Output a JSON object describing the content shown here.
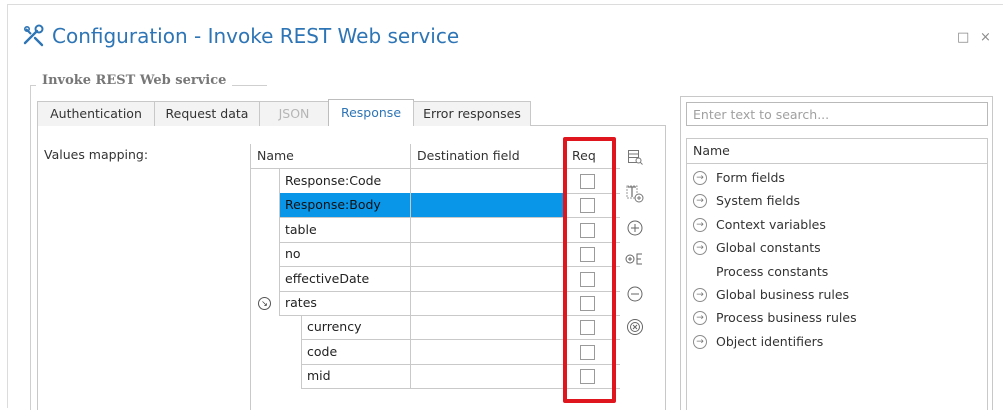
{
  "window": {
    "title": "Configuration - Invoke REST Web service",
    "title_color": "#2e75b6",
    "maximize_glyph": "□",
    "close_glyph": "×"
  },
  "group": {
    "title": "Invoke REST Web service"
  },
  "tabs": [
    {
      "label": "Authentication",
      "state": "normal"
    },
    {
      "label": "Request data",
      "state": "normal"
    },
    {
      "label": "JSON",
      "state": "disabled"
    },
    {
      "label": "Response",
      "state": "active"
    },
    {
      "label": "Error responses",
      "state": "normal"
    }
  ],
  "values_mapping_label": "Values mapping:",
  "grid": {
    "columns": [
      "Name",
      "Destination field",
      "Req"
    ],
    "rows": [
      {
        "name": "Response:Code",
        "dest": "",
        "req": false,
        "level": 0,
        "selected": false
      },
      {
        "name": "Response:Body",
        "dest": "",
        "req": false,
        "level": 0,
        "selected": true
      },
      {
        "name": "table",
        "dest": "",
        "req": false,
        "level": 0,
        "selected": false
      },
      {
        "name": "no",
        "dest": "",
        "req": false,
        "level": 0,
        "selected": false
      },
      {
        "name": "effectiveDate",
        "dest": "",
        "req": false,
        "level": 0,
        "selected": false
      },
      {
        "name": "rates",
        "dest": "",
        "req": false,
        "level": 0,
        "selected": false,
        "expander": true
      },
      {
        "name": "currency",
        "dest": "",
        "req": false,
        "level": 1,
        "selected": false
      },
      {
        "name": "code",
        "dest": "",
        "req": false,
        "level": 1,
        "selected": false
      },
      {
        "name": "mid",
        "dest": "",
        "req": false,
        "level": 1,
        "selected": false
      }
    ],
    "selection_color": "#0a96e8",
    "highlight_color": "#e0161f"
  },
  "side_tools": [
    {
      "icon": "table-search-icon",
      "glyph": "▤"
    },
    {
      "icon": "add-text-field-icon",
      "glyph": "⊞"
    },
    {
      "icon": "add-circle-icon",
      "glyph": "⊕"
    },
    {
      "icon": "add-child-icon",
      "glyph": "⊕E"
    },
    {
      "icon": "remove-circle-icon",
      "glyph": "⊖"
    },
    {
      "icon": "delete-circle-icon",
      "glyph": "⊗"
    }
  ],
  "search": {
    "placeholder": "Enter text to search..."
  },
  "tree": {
    "header": "Name",
    "items": [
      {
        "label": "Form fields",
        "arrow": true
      },
      {
        "label": "System fields",
        "arrow": true
      },
      {
        "label": "Context variables",
        "arrow": true
      },
      {
        "label": "Global constants",
        "arrow": true
      },
      {
        "label": "Process constants",
        "arrow": false
      },
      {
        "label": "Global business rules",
        "arrow": true
      },
      {
        "label": "Process business rules",
        "arrow": true
      },
      {
        "label": "Object identifiers",
        "arrow": true
      }
    ]
  }
}
